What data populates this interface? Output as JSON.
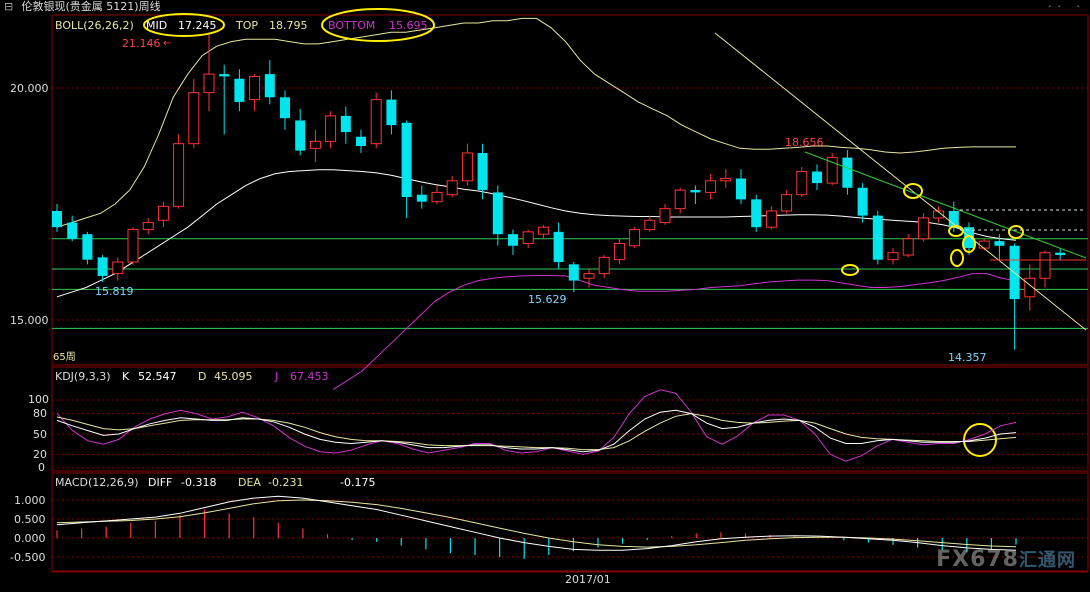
{
  "window": {
    "title": "伦敦银现(贵金属 5121)周线"
  },
  "colors": {
    "up": "#ff3333",
    "down": "#00e5ee",
    "bg": "#000000",
    "grid": "#8b0000",
    "mid": "#ffffff",
    "top": "#e6e6a0",
    "bottom": "#cc33cc",
    "hline": "#33cc55"
  },
  "boll": {
    "name": "BOLL(26,26,2)",
    "mid_label": "MID",
    "mid_value": "17.245",
    "top_label": "TOP",
    "top_value": "18.795",
    "bottom_label": "BOTTOM",
    "bottom_value": "15.695"
  },
  "price_axis": {
    "labels": [
      "20.000",
      "15.000"
    ]
  },
  "price_annotations": {
    "high": "21.146",
    "low1": "15.819",
    "low2": "15.629",
    "high2": "18.656",
    "low3": "14.357",
    "period": "65周"
  },
  "kdj": {
    "name": "KDJ(9,3,3)",
    "k_label": "K",
    "k_value": "52.547",
    "d_label": "D",
    "d_value": "45.095",
    "j_label": "J",
    "j_value": "67.453",
    "axis": [
      "100",
      "80",
      "50",
      "20",
      "0"
    ]
  },
  "macd": {
    "name": "MACD(12,26,9)",
    "diff_label": "DIFF",
    "diff_value": "-0.318",
    "dea_label": "DEA",
    "dea_value": "-0.231",
    "macd_value": "-0.175",
    "axis": [
      "1.000",
      "0.500",
      "0.000",
      "-0.500"
    ]
  },
  "time_axis": {
    "label": "2017/01"
  },
  "watermark": {
    "text": "FX678",
    "suffix": "汇通网"
  },
  "chart_data": {
    "type": "candlestick",
    "title": "伦敦银现(贵金属 5121)周线",
    "ylim": [
      14.0,
      21.6
    ],
    "candles": [
      {
        "o": 17.35,
        "h": 17.5,
        "c": 17.0,
        "l": 16.9
      },
      {
        "o": 17.1,
        "h": 17.25,
        "c": 16.75,
        "l": 16.7
      },
      {
        "o": 16.85,
        "h": 16.9,
        "c": 16.3,
        "l": 16.2
      },
      {
        "o": 16.35,
        "h": 16.4,
        "c": 15.95,
        "l": 15.82
      },
      {
        "o": 16.0,
        "h": 16.35,
        "c": 16.25,
        "l": 15.85
      },
      {
        "o": 16.25,
        "h": 17.0,
        "c": 16.95,
        "l": 16.2
      },
      {
        "o": 16.95,
        "h": 17.2,
        "c": 17.1,
        "l": 16.85
      },
      {
        "o": 17.15,
        "h": 17.55,
        "c": 17.45,
        "l": 17.0
      },
      {
        "o": 17.45,
        "h": 19.0,
        "c": 18.8,
        "l": 17.4
      },
      {
        "o": 18.8,
        "h": 20.2,
        "c": 19.9,
        "l": 18.7
      },
      {
        "o": 19.9,
        "h": 21.15,
        "c": 20.3,
        "l": 19.5
      },
      {
        "o": 20.3,
        "h": 20.5,
        "c": 20.25,
        "l": 19.0
      },
      {
        "o": 20.2,
        "h": 20.4,
        "c": 19.7,
        "l": 19.5
      },
      {
        "o": 19.75,
        "h": 20.3,
        "c": 20.25,
        "l": 19.5
      },
      {
        "o": 20.3,
        "h": 20.6,
        "c": 19.8,
        "l": 19.65
      },
      {
        "o": 19.8,
        "h": 19.95,
        "c": 19.35,
        "l": 19.1
      },
      {
        "o": 19.3,
        "h": 19.55,
        "c": 18.65,
        "l": 18.55
      },
      {
        "o": 18.7,
        "h": 19.1,
        "c": 18.85,
        "l": 18.4
      },
      {
        "o": 18.85,
        "h": 19.5,
        "c": 19.4,
        "l": 18.7
      },
      {
        "o": 19.4,
        "h": 19.6,
        "c": 19.05,
        "l": 18.8
      },
      {
        "o": 18.95,
        "h": 19.1,
        "c": 18.75,
        "l": 18.6
      },
      {
        "o": 18.8,
        "h": 19.9,
        "c": 19.75,
        "l": 18.7
      },
      {
        "o": 19.75,
        "h": 19.95,
        "c": 19.2,
        "l": 19.0
      },
      {
        "o": 19.25,
        "h": 19.3,
        "c": 17.65,
        "l": 17.2
      },
      {
        "o": 17.7,
        "h": 17.9,
        "c": 17.55,
        "l": 17.4
      },
      {
        "o": 17.55,
        "h": 17.9,
        "c": 17.75,
        "l": 17.5
      },
      {
        "o": 17.7,
        "h": 18.1,
        "c": 18.0,
        "l": 17.65
      },
      {
        "o": 18.0,
        "h": 18.8,
        "c": 18.6,
        "l": 17.9
      },
      {
        "o": 18.6,
        "h": 18.8,
        "c": 17.8,
        "l": 17.6
      },
      {
        "o": 17.75,
        "h": 17.9,
        "c": 16.85,
        "l": 16.6
      },
      {
        "o": 16.85,
        "h": 16.95,
        "c": 16.6,
        "l": 16.4
      },
      {
        "o": 16.65,
        "h": 16.95,
        "c": 16.9,
        "l": 16.55
      },
      {
        "o": 16.85,
        "h": 17.05,
        "c": 17.0,
        "l": 16.75
      },
      {
        "o": 16.9,
        "h": 17.1,
        "c": 16.25,
        "l": 16.1
      },
      {
        "o": 16.2,
        "h": 16.25,
        "c": 15.85,
        "l": 15.6
      },
      {
        "o": 15.9,
        "h": 16.1,
        "c": 16.0,
        "l": 15.7
      },
      {
        "o": 16.0,
        "h": 16.4,
        "c": 16.35,
        "l": 15.9
      },
      {
        "o": 16.3,
        "h": 16.75,
        "c": 16.65,
        "l": 16.2
      },
      {
        "o": 16.6,
        "h": 17.0,
        "c": 16.95,
        "l": 16.55
      },
      {
        "o": 16.95,
        "h": 17.25,
        "c": 17.15,
        "l": 16.9
      },
      {
        "o": 17.1,
        "h": 17.5,
        "c": 17.4,
        "l": 17.05
      },
      {
        "o": 17.4,
        "h": 17.85,
        "c": 17.8,
        "l": 17.3
      },
      {
        "o": 17.8,
        "h": 17.9,
        "c": 17.75,
        "l": 17.5
      },
      {
        "o": 17.75,
        "h": 18.15,
        "c": 18.0,
        "l": 17.6
      },
      {
        "o": 18.0,
        "h": 18.25,
        "c": 18.05,
        "l": 17.85
      },
      {
        "o": 18.05,
        "h": 18.25,
        "c": 17.6,
        "l": 17.5
      },
      {
        "o": 17.6,
        "h": 17.7,
        "c": 17.0,
        "l": 16.9
      },
      {
        "o": 17.0,
        "h": 17.45,
        "c": 17.35,
        "l": 16.95
      },
      {
        "o": 17.35,
        "h": 17.8,
        "c": 17.7,
        "l": 17.3
      },
      {
        "o": 17.7,
        "h": 18.3,
        "c": 18.2,
        "l": 17.65
      },
      {
        "o": 18.2,
        "h": 18.35,
        "c": 17.95,
        "l": 17.8
      },
      {
        "o": 17.95,
        "h": 18.6,
        "c": 18.5,
        "l": 17.9
      },
      {
        "o": 18.5,
        "h": 18.66,
        "c": 17.85,
        "l": 17.7
      },
      {
        "o": 17.85,
        "h": 17.95,
        "c": 17.25,
        "l": 17.1
      },
      {
        "o": 17.25,
        "h": 17.35,
        "c": 16.3,
        "l": 16.2
      },
      {
        "o": 16.3,
        "h": 16.55,
        "c": 16.45,
        "l": 16.2
      },
      {
        "o": 16.4,
        "h": 16.85,
        "c": 16.75,
        "l": 16.35
      },
      {
        "o": 16.75,
        "h": 17.3,
        "c": 17.2,
        "l": 16.7
      },
      {
        "o": 17.2,
        "h": 17.45,
        "c": 17.35,
        "l": 17.1
      },
      {
        "o": 17.35,
        "h": 17.55,
        "c": 17.0,
        "l": 16.9
      },
      {
        "o": 17.0,
        "h": 17.1,
        "c": 16.55,
        "l": 16.4
      },
      {
        "o": 16.55,
        "h": 16.75,
        "c": 16.7,
        "l": 16.5
      },
      {
        "o": 16.7,
        "h": 16.85,
        "c": 16.6,
        "l": 16.3
      },
      {
        "o": 16.6,
        "h": 16.65,
        "c": 15.45,
        "l": 14.36
      },
      {
        "o": 15.5,
        "h": 16.2,
        "c": 15.9,
        "l": 15.2
      },
      {
        "o": 15.9,
        "h": 16.5,
        "c": 16.45,
        "l": 15.7
      },
      {
        "o": 16.45,
        "h": 16.55,
        "c": 16.4,
        "l": 16.3
      }
    ],
    "boll_mid": [
      15.5,
      15.6,
      15.7,
      15.85,
      16.0,
      16.2,
      16.4,
      16.6,
      16.8,
      17.0,
      17.25,
      17.5,
      17.7,
      17.9,
      18.05,
      18.15,
      18.2,
      18.22,
      18.24,
      18.24,
      18.22,
      18.2,
      18.17,
      18.12,
      18.05,
      17.98,
      17.92,
      17.87,
      17.82,
      17.78,
      17.72,
      17.65,
      17.58,
      17.5,
      17.42,
      17.35,
      17.3,
      17.27,
      17.25,
      17.24,
      17.23,
      17.23,
      17.22,
      17.22,
      17.22,
      17.22,
      17.22,
      17.23,
      17.24,
      17.25,
      17.26,
      17.27,
      17.27,
      17.26,
      17.24,
      17.21,
      17.18,
      17.16,
      17.14,
      17.12,
      17.1,
      17.05,
      16.98,
      16.88,
      16.8,
      16.75,
      16.72
    ],
    "boll_top": [
      17.0,
      17.1,
      17.2,
      17.3,
      17.5,
      17.8,
      18.3,
      19.0,
      19.8,
      20.3,
      20.7,
      20.9,
      21.0,
      21.05,
      21.05,
      21.05,
      21.0,
      20.95,
      20.95,
      21.0,
      21.05,
      21.1,
      21.15,
      21.2,
      21.2,
      21.25,
      21.3,
      21.35,
      21.4,
      21.4,
      21.45,
      21.45,
      21.5,
      21.5,
      21.3,
      21.0,
      20.6,
      20.3,
      20.1,
      19.9,
      19.7,
      19.55,
      19.4,
      19.2,
      19.05,
      18.9,
      18.8,
      18.7,
      18.68,
      18.68,
      18.7,
      18.72,
      18.75,
      18.75,
      18.72,
      18.7,
      18.67,
      18.62,
      18.6,
      18.62,
      18.66,
      18.7,
      18.72,
      18.73,
      18.73,
      18.73,
      18.73
    ],
    "boll_bottom": [
      null,
      null,
      null,
      null,
      null,
      null,
      null,
      null,
      null,
      null,
      null,
      null,
      null,
      null,
      null,
      null,
      null,
      null,
      null,
      13.5,
      13.7,
      13.9,
      14.2,
      14.5,
      14.8,
      15.1,
      15.4,
      15.6,
      15.75,
      15.85,
      15.9,
      15.93,
      15.95,
      15.96,
      15.96,
      15.95,
      15.85,
      15.75,
      15.7,
      15.65,
      15.62,
      15.62,
      15.62,
      15.64,
      15.66,
      15.7,
      15.72,
      15.74,
      15.78,
      15.82,
      15.84,
      15.86,
      15.86,
      15.85,
      15.8,
      15.75,
      15.7,
      15.7,
      15.72,
      15.76,
      15.8,
      15.85,
      15.92,
      16.0,
      16.0,
      15.9,
      15.85
    ],
    "kdj_k": [
      70,
      62,
      55,
      48,
      50,
      58,
      65,
      70,
      74,
      72,
      70,
      70,
      74,
      72,
      68,
      60,
      50,
      42,
      38,
      36,
      38,
      40,
      38,
      34,
      30,
      30,
      32,
      34,
      34,
      30,
      28,
      28,
      30,
      27,
      24,
      26,
      35,
      55,
      72,
      82,
      85,
      80,
      66,
      58,
      60,
      66,
      70,
      72,
      70,
      60,
      44,
      36,
      36,
      40,
      42,
      40,
      38,
      38,
      38,
      40,
      44,
      50,
      52
    ],
    "kdj_d": [
      75,
      70,
      64,
      58,
      56,
      58,
      62,
      66,
      70,
      71,
      71,
      71,
      72,
      72,
      70,
      66,
      60,
      52,
      46,
      42,
      40,
      40,
      39,
      37,
      34,
      33,
      33,
      33,
      33,
      32,
      31,
      30,
      30,
      29,
      27,
      27,
      30,
      40,
      54,
      66,
      76,
      80,
      76,
      70,
      67,
      66,
      67,
      69,
      70,
      66,
      58,
      50,
      45,
      43,
      42,
      41,
      40,
      39,
      39,
      39,
      41,
      43,
      45
    ],
    "kdj_j": [
      80,
      55,
      40,
      35,
      42,
      60,
      72,
      80,
      85,
      80,
      72,
      75,
      82,
      74,
      62,
      45,
      32,
      24,
      22,
      26,
      34,
      40,
      36,
      28,
      22,
      26,
      30,
      36,
      36,
      26,
      22,
      24,
      30,
      25,
      20,
      25,
      45,
      80,
      105,
      115,
      110,
      82,
      46,
      35,
      47,
      66,
      78,
      78,
      70,
      50,
      20,
      10,
      18,
      32,
      42,
      38,
      34,
      36,
      36,
      42,
      50,
      62,
      67
    ],
    "macd_diff": [
      0.35,
      0.4,
      0.45,
      0.5,
      0.55,
      0.65,
      0.8,
      0.95,
      1.05,
      1.1,
      1.05,
      0.95,
      0.85,
      0.75,
      0.6,
      0.45,
      0.3,
      0.15,
      0.0,
      -0.12,
      -0.22,
      -0.3,
      -0.32,
      -0.32,
      -0.28,
      -0.2,
      -0.1,
      -0.02,
      0.02,
      0.05,
      0.06,
      0.05,
      0.02,
      -0.02,
      -0.06,
      -0.12,
      -0.2,
      -0.26,
      -0.3,
      -0.32
    ],
    "macd_dea": [
      0.4,
      0.42,
      0.44,
      0.46,
      0.5,
      0.56,
      0.66,
      0.78,
      0.9,
      0.98,
      1.0,
      0.98,
      0.94,
      0.88,
      0.78,
      0.66,
      0.54,
      0.4,
      0.26,
      0.12,
      0.0,
      -0.1,
      -0.18,
      -0.22,
      -0.24,
      -0.22,
      -0.18,
      -0.12,
      -0.06,
      -0.02,
      0.01,
      0.02,
      0.02,
      0.0,
      -0.03,
      -0.07,
      -0.12,
      -0.17,
      -0.21,
      -0.23
    ],
    "macd_hist": [
      0.2,
      0.25,
      0.3,
      0.4,
      0.45,
      0.6,
      0.75,
      0.65,
      0.55,
      0.4,
      0.25,
      0.1,
      -0.05,
      -0.1,
      -0.2,
      -0.3,
      -0.4,
      -0.45,
      -0.5,
      -0.55,
      -0.45,
      -0.35,
      -0.25,
      -0.15,
      -0.05,
      0.05,
      0.12,
      0.15,
      0.12,
      0.08,
      0.04,
      0.0,
      -0.06,
      -0.12,
      -0.18,
      -0.25,
      -0.32,
      -0.38,
      -0.3,
      -0.175
    ],
    "horizontal_levels": [
      16.75,
      16.1,
      15.66,
      14.82
    ]
  }
}
